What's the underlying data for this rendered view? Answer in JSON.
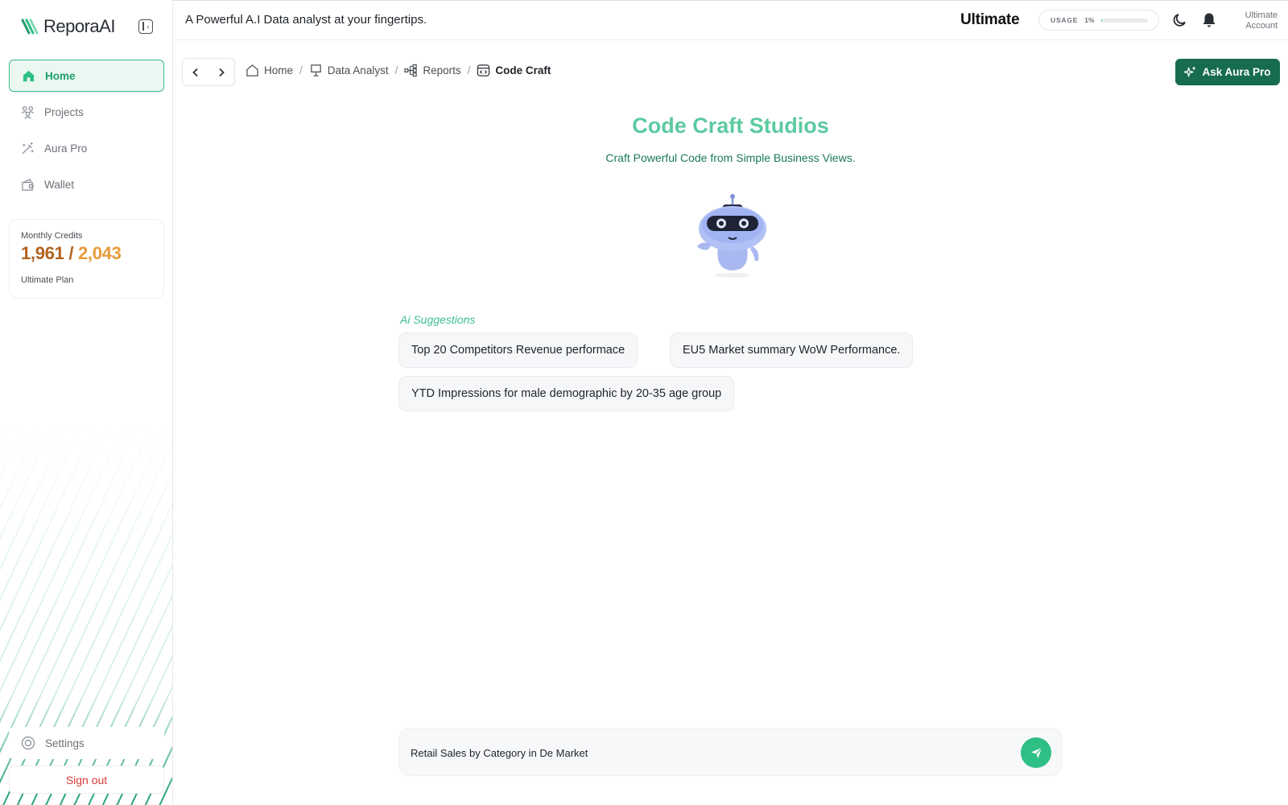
{
  "brand": {
    "name": "ReporaAI",
    "accent": "#2ebf85",
    "dark_accent": "#176b51"
  },
  "topbar": {
    "tagline": "A Powerful A.I Data analyst at your fingertips.",
    "plan": "Ultimate",
    "usage_label": "USAGE",
    "usage_percent": "1%",
    "usage_fraction": 0.01,
    "account_line1": "Ultimate",
    "account_line2": "Account"
  },
  "sidebar": {
    "items": [
      {
        "label": "Home",
        "icon": "home-icon",
        "active": true
      },
      {
        "label": "Projects",
        "icon": "projects-icon",
        "active": false
      },
      {
        "label": "Aura Pro",
        "icon": "magic-wand-icon",
        "active": false
      },
      {
        "label": "Wallet",
        "icon": "wallet-icon",
        "active": false
      }
    ],
    "credits": {
      "label": "Monthly Credits",
      "used": "1,961",
      "separator": "/",
      "total": "2,043",
      "plan": "Ultimate Plan"
    },
    "settings_label": "Settings",
    "signout_label": "Sign out"
  },
  "breadcrumb": [
    {
      "label": "Home",
      "icon": "home-icon"
    },
    {
      "label": "Data Analyst",
      "icon": "presentation-icon"
    },
    {
      "label": "Reports",
      "icon": "hierarchy-icon"
    },
    {
      "label": "Code Craft",
      "icon": "code-window-icon"
    }
  ],
  "breadcrumb_separator": "/",
  "ask_button": "Ask Aura Pro",
  "hero": {
    "title": "Code Craft Studios",
    "subtitle": "Craft Powerful Code from Simple Business Views."
  },
  "suggestions": {
    "label": "Ai Suggestions",
    "items": [
      "Top 20 Competitors Revenue performace",
      "EU5 Market summary WoW Performance.",
      "YTD Impressions for male demographic by 20-35 age group"
    ]
  },
  "query": {
    "value": "Retail Sales by Category in De Market",
    "placeholder": ""
  }
}
